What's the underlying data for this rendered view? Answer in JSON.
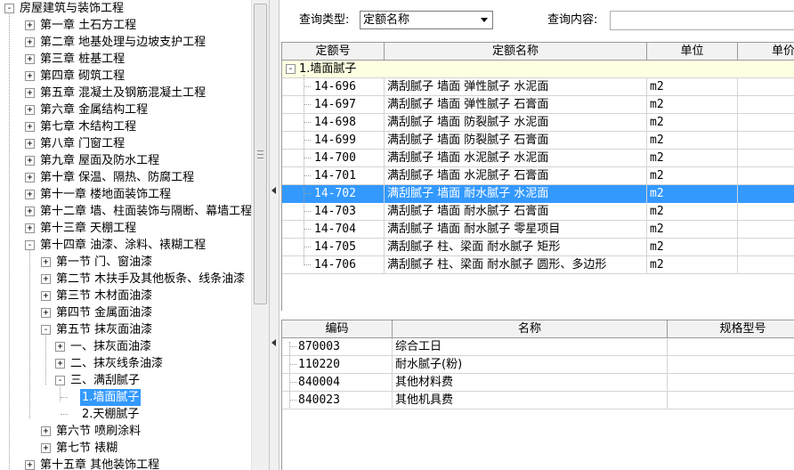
{
  "tree": {
    "root": "房屋建筑与装饰工程",
    "chapters": [
      {
        "label": "第一章  土石方工程",
        "toggle": "+"
      },
      {
        "label": "第二章  地基处理与边坡支护工程",
        "toggle": "+"
      },
      {
        "label": "第三章  桩基工程",
        "toggle": "+"
      },
      {
        "label": "第四章  砌筑工程",
        "toggle": "+"
      },
      {
        "label": "第五章  混凝土及钢筋混凝土工程",
        "toggle": "+"
      },
      {
        "label": "第六章  金属结构工程",
        "toggle": "+"
      },
      {
        "label": "第七章  木结构工程",
        "toggle": "+"
      },
      {
        "label": "第八章  门窗工程",
        "toggle": "+"
      },
      {
        "label": "第九章  屋面及防水工程",
        "toggle": "+"
      },
      {
        "label": "第十章  保温、隔热、防腐工程",
        "toggle": "+"
      },
      {
        "label": "第十一章  楼地面装饰工程",
        "toggle": "+"
      },
      {
        "label": "第十二章  墙、柱面装饰与隔断、幕墙工程",
        "toggle": "+"
      },
      {
        "label": "第十三章  天棚工程",
        "toggle": "+"
      },
      {
        "label": "第十四章  油漆、涂料、裱糊工程",
        "toggle": "-"
      }
    ],
    "sections": [
      {
        "label": "第一节  门、窗油漆",
        "toggle": "+"
      },
      {
        "label": "第二节  木扶手及其他板条、线条油漆",
        "toggle": "+"
      },
      {
        "label": "第三节  木材面油漆",
        "toggle": "+"
      },
      {
        "label": "第四节  金属面油漆",
        "toggle": "+"
      },
      {
        "label": "第五节  抹灰面油漆",
        "toggle": "-"
      }
    ],
    "subsections": [
      {
        "label": "一、抹灰面油漆",
        "toggle": "+"
      },
      {
        "label": "二、抹灰线条油漆",
        "toggle": "+"
      },
      {
        "label": "三、满刮腻子",
        "toggle": "-"
      }
    ],
    "leaves": [
      {
        "label": "1.墙面腻子",
        "selected": true
      },
      {
        "label": "2.天棚腻子",
        "selected": false
      }
    ],
    "after_sections": [
      {
        "label": "第六节  喷刷涂料",
        "toggle": "+"
      },
      {
        "label": "第七节  裱糊",
        "toggle": "+"
      }
    ],
    "last_chapter": {
      "label": "第十五章  其他装饰工程",
      "toggle": "+"
    }
  },
  "query": {
    "type_label": "查询类型:",
    "type_value": "定额名称",
    "content_label": "查询内容:",
    "content_value": ""
  },
  "quota_table": {
    "headers": [
      "定额号",
      "定额名称",
      "单位",
      "单价"
    ],
    "group": {
      "toggle": "-",
      "label": "1.墙面腻子"
    },
    "rows": [
      {
        "code": "14-696",
        "name": "满刮腻子  墙面  弹性腻子  水泥面",
        "unit": "m2"
      },
      {
        "code": "14-697",
        "name": "满刮腻子  墙面  弹性腻子  石膏面",
        "unit": "m2"
      },
      {
        "code": "14-698",
        "name": "满刮腻子  墙面  防裂腻子  水泥面",
        "unit": "m2"
      },
      {
        "code": "14-699",
        "name": "满刮腻子  墙面  防裂腻子  石膏面",
        "unit": "m2"
      },
      {
        "code": "14-700",
        "name": "满刮腻子  墙面  水泥腻子  水泥面",
        "unit": "m2"
      },
      {
        "code": "14-701",
        "name": "满刮腻子  墙面  水泥腻子  石膏面",
        "unit": "m2"
      },
      {
        "code": "14-702",
        "name": "满刮腻子  墙面  耐水腻子  水泥面",
        "unit": "m2",
        "selected": true
      },
      {
        "code": "14-703",
        "name": "满刮腻子  墙面  耐水腻子  石膏面",
        "unit": "m2"
      },
      {
        "code": "14-704",
        "name": "满刮腻子  墙面  耐水腻子  零星项目",
        "unit": "m2"
      },
      {
        "code": "14-705",
        "name": "满刮腻子  柱、梁面  耐水腻子  矩形",
        "unit": "m2"
      },
      {
        "code": "14-706",
        "name": "满刮腻子  柱、梁面  耐水腻子  圆形、多边形",
        "unit": "m2"
      }
    ]
  },
  "resource_table": {
    "headers": [
      "编码",
      "名称",
      "规格型号"
    ],
    "rows": [
      {
        "code": "870003",
        "name": "综合工日"
      },
      {
        "code": "110220",
        "name": "耐水腻子(粉)"
      },
      {
        "code": "840004",
        "name": "其他材料费"
      },
      {
        "code": "840023",
        "name": "其他机具费"
      }
    ]
  },
  "colors": {
    "selection": "#3399ff",
    "group_row": "#ffffe1"
  }
}
